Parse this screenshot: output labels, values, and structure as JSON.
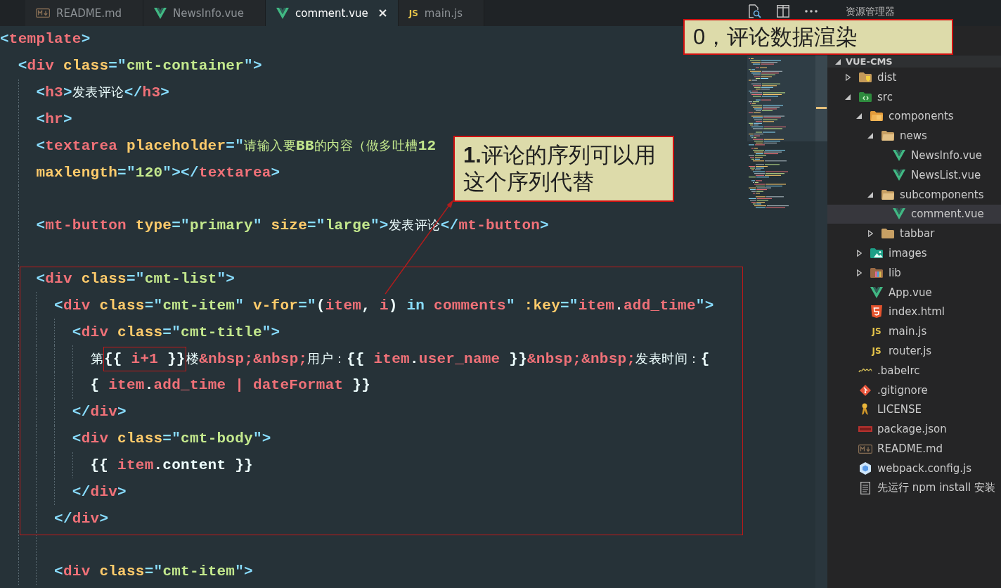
{
  "tabs": [
    {
      "label": "README.md",
      "kind": "markdown",
      "selected": false
    },
    {
      "label": "NewsInfo.vue",
      "kind": "vue",
      "selected": false
    },
    {
      "label": "comment.vue",
      "kind": "vue",
      "selected": true
    },
    {
      "label": "main.js",
      "kind": "js",
      "badge": "JS",
      "selected": false
    }
  ],
  "editor": {
    "lines": [
      {
        "kind": "code",
        "tokens": [
          {
            "kind": "punct",
            "text": "<"
          },
          {
            "kind": "tag",
            "text": "template"
          },
          {
            "kind": "punct",
            "text": ">"
          }
        ],
        "children": [
          {
            "kind": "code",
            "tokens": [
              {
                "kind": "punct",
                "text": "<"
              },
              {
                "kind": "tag",
                "text": "div"
              },
              {
                "kind": "attr",
                "text": " class"
              },
              {
                "kind": "punct",
                "text": "=\""
              },
              {
                "kind": "string",
                "text": "cmt-container"
              },
              {
                "kind": "punct",
                "text": "\">"
              }
            ],
            "children": [
              {
                "kind": "code",
                "tokens": [
                  {
                    "kind": "punct",
                    "text": "<"
                  },
                  {
                    "kind": "tag",
                    "text": "h3"
                  },
                  {
                    "kind": "punct",
                    "text": ">"
                  },
                  {
                    "kind": "text",
                    "text": "发表评论"
                  },
                  {
                    "kind": "punct",
                    "text": "</"
                  },
                  {
                    "kind": "tag",
                    "text": "h3"
                  },
                  {
                    "kind": "punct",
                    "text": ">"
                  }
                ]
              },
              {
                "kind": "code",
                "tokens": [
                  {
                    "kind": "punct",
                    "text": "<"
                  },
                  {
                    "kind": "tag",
                    "text": "hr"
                  },
                  {
                    "kind": "punct",
                    "text": ">"
                  }
                ]
              },
              {
                "kind": "code",
                "tokens": [
                  {
                    "kind": "punct",
                    "text": "<"
                  },
                  {
                    "kind": "tag",
                    "text": "textarea"
                  },
                  {
                    "kind": "attr",
                    "text": " placeholder"
                  },
                  {
                    "kind": "punct",
                    "text": "=\""
                  },
                  {
                    "kind": "string",
                    "text": "请输入要BB的内容（做多吐槽12"
                  }
                ]
              },
              {
                "kind": "code",
                "tokens": [
                  {
                    "kind": "attr",
                    "text": "maxlength"
                  },
                  {
                    "kind": "punct",
                    "text": "=\""
                  },
                  {
                    "kind": "string",
                    "text": "120"
                  },
                  {
                    "kind": "punct",
                    "text": "\"></"
                  },
                  {
                    "kind": "tag",
                    "text": "textarea"
                  },
                  {
                    "kind": "punct",
                    "text": ">"
                  }
                ]
              },
              {
                "kind": "blank"
              },
              {
                "kind": "code",
                "tokens": [
                  {
                    "kind": "punct",
                    "text": "<"
                  },
                  {
                    "kind": "tag",
                    "text": "mt-button"
                  },
                  {
                    "kind": "attr",
                    "text": " type"
                  },
                  {
                    "kind": "punct",
                    "text": "=\""
                  },
                  {
                    "kind": "string",
                    "text": "primary"
                  },
                  {
                    "kind": "punct",
                    "text": "\""
                  },
                  {
                    "kind": "attr",
                    "text": " size"
                  },
                  {
                    "kind": "punct",
                    "text": "=\""
                  },
                  {
                    "kind": "string",
                    "text": "large"
                  },
                  {
                    "kind": "punct",
                    "text": "\">"
                  },
                  {
                    "kind": "text",
                    "text": "发表评论"
                  },
                  {
                    "kind": "punct",
                    "text": "</"
                  },
                  {
                    "kind": "tag",
                    "text": "mt-button"
                  },
                  {
                    "kind": "punct",
                    "text": ">"
                  }
                ]
              },
              {
                "kind": "blank"
              },
              {
                "kind": "code",
                "tokens": [
                  {
                    "kind": "punct",
                    "text": "<"
                  },
                  {
                    "kind": "tag",
                    "text": "div"
                  },
                  {
                    "kind": "attr",
                    "text": " class"
                  },
                  {
                    "kind": "punct",
                    "text": "=\""
                  },
                  {
                    "kind": "string",
                    "text": "cmt-list"
                  },
                  {
                    "kind": "punct",
                    "text": "\">"
                  }
                ],
                "children": [
                  {
                    "kind": "code",
                    "tokens": [
                      {
                        "kind": "punct",
                        "text": "<"
                      },
                      {
                        "kind": "tag",
                        "text": "div"
                      },
                      {
                        "kind": "attr",
                        "text": " class"
                      },
                      {
                        "kind": "punct",
                        "text": "=\""
                      },
                      {
                        "kind": "string",
                        "text": "cmt-item"
                      },
                      {
                        "kind": "punct",
                        "text": "\""
                      },
                      {
                        "kind": "attr",
                        "text": " v-for"
                      },
                      {
                        "kind": "punct",
                        "text": "=\""
                      },
                      {
                        "kind": "text",
                        "text": "("
                      },
                      {
                        "kind": "var",
                        "text": "item"
                      },
                      {
                        "kind": "text",
                        "text": ", "
                      },
                      {
                        "kind": "var",
                        "text": "i"
                      },
                      {
                        "kind": "text",
                        "text": ") "
                      },
                      {
                        "kind": "keyword",
                        "text": "in"
                      },
                      {
                        "kind": "var",
                        "text": " comments"
                      },
                      {
                        "kind": "punct",
                        "text": "\""
                      },
                      {
                        "kind": "attr",
                        "text": " :key"
                      },
                      {
                        "kind": "punct",
                        "text": "=\""
                      },
                      {
                        "kind": "var",
                        "text": "item"
                      },
                      {
                        "kind": "text",
                        "text": "."
                      },
                      {
                        "kind": "var",
                        "text": "add_time"
                      },
                      {
                        "kind": "punct",
                        "text": "\">"
                      }
                    ],
                    "children": [
                      {
                        "kind": "code",
                        "tokens": [
                          {
                            "kind": "punct",
                            "text": "<"
                          },
                          {
                            "kind": "tag",
                            "text": "div"
                          },
                          {
                            "kind": "attr",
                            "text": " class"
                          },
                          {
                            "kind": "punct",
                            "text": "=\""
                          },
                          {
                            "kind": "string",
                            "text": "cmt-title"
                          },
                          {
                            "kind": "punct",
                            "text": "\">"
                          }
                        ],
                        "children": [
                          {
                            "kind": "code",
                            "tokens": [
                              {
                                "kind": "text",
                                "text": "第"
                              },
                              {
                                "kind": "framed",
                                "tokens": [
                                  {
                                    "kind": "text",
                                    "text": "{{ "
                                  },
                                  {
                                    "kind": "var",
                                    "text": "i+1"
                                  },
                                  {
                                    "kind": "text",
                                    "text": " }}"
                                  }
                                ]
                              },
                              {
                                "kind": "text",
                                "text": "楼"
                              },
                              {
                                "kind": "var",
                                "text": "&nbsp;&nbsp;"
                              },
                              {
                                "kind": "text",
                                "text": "用户：{{ "
                              },
                              {
                                "kind": "var",
                                "text": "item"
                              },
                              {
                                "kind": "text",
                                "text": "."
                              },
                              {
                                "kind": "var",
                                "text": "user_name"
                              },
                              {
                                "kind": "text",
                                "text": " }}"
                              },
                              {
                                "kind": "var",
                                "text": "&nbsp;&nbsp;"
                              },
                              {
                                "kind": "text",
                                "text": "发表时间：{"
                              }
                            ]
                          },
                          {
                            "kind": "code",
                            "tokens": [
                              {
                                "kind": "text",
                                "text": "{ "
                              },
                              {
                                "kind": "var",
                                "text": "item"
                              },
                              {
                                "kind": "text",
                                "text": "."
                              },
                              {
                                "kind": "var",
                                "text": "add_time | dateFormat"
                              },
                              {
                                "kind": "text",
                                "text": " }}"
                              }
                            ]
                          }
                        ]
                      },
                      {
                        "kind": "code",
                        "tokens": [
                          {
                            "kind": "punct",
                            "text": "</"
                          },
                          {
                            "kind": "tag",
                            "text": "div"
                          },
                          {
                            "kind": "punct",
                            "text": ">"
                          }
                        ]
                      },
                      {
                        "kind": "code",
                        "tokens": [
                          {
                            "kind": "punct",
                            "text": "<"
                          },
                          {
                            "kind": "tag",
                            "text": "div"
                          },
                          {
                            "kind": "attr",
                            "text": " class"
                          },
                          {
                            "kind": "punct",
                            "text": "=\""
                          },
                          {
                            "kind": "string",
                            "text": "cmt-body"
                          },
                          {
                            "kind": "punct",
                            "text": "\">"
                          }
                        ],
                        "children": [
                          {
                            "kind": "code",
                            "tokens": [
                              {
                                "kind": "text",
                                "text": "{{ "
                              },
                              {
                                "kind": "var",
                                "text": "item"
                              },
                              {
                                "kind": "text",
                                "text": ".content }}"
                              }
                            ]
                          }
                        ]
                      },
                      {
                        "kind": "code",
                        "tokens": [
                          {
                            "kind": "punct",
                            "text": "</"
                          },
                          {
                            "kind": "tag",
                            "text": "div"
                          },
                          {
                            "kind": "punct",
                            "text": ">"
                          }
                        ]
                      }
                    ]
                  },
                  {
                    "kind": "code",
                    "tokens": [
                      {
                        "kind": "punct",
                        "text": "</"
                      },
                      {
                        "kind": "tag",
                        "text": "div"
                      },
                      {
                        "kind": "punct",
                        "text": ">"
                      }
                    ]
                  },
                  {
                    "kind": "blank"
                  },
                  {
                    "kind": "code",
                    "tokens": [
                      {
                        "kind": "punct",
                        "text": "<"
                      },
                      {
                        "kind": "tag",
                        "text": "div"
                      },
                      {
                        "kind": "attr",
                        "text": " class"
                      },
                      {
                        "kind": "punct",
                        "text": "=\""
                      },
                      {
                        "kind": "string",
                        "text": "cmt-item"
                      },
                      {
                        "kind": "punct",
                        "text": "\">"
                      }
                    ]
                  }
                ]
              }
            ]
          }
        ]
      }
    ]
  },
  "sidebar": {
    "title": "资源管理器",
    "project": {
      "name": "VUE-CMS",
      "expanded": true
    },
    "tree": [
      {
        "name": "dist",
        "kind": "distfolder",
        "expanded": false,
        "selected": false
      },
      {
        "name": "src",
        "kind": "srcfolder",
        "expanded": true,
        "selected": false,
        "children": [
          {
            "name": "components",
            "kind": "componentsfolder",
            "expanded": true,
            "selected": false,
            "children": [
              {
                "name": "news",
                "kind": "folder",
                "expanded": true,
                "selected": false,
                "children": [
                  {
                    "name": "NewsInfo.vue",
                    "kind": "vue",
                    "selected": false
                  },
                  {
                    "name": "NewsList.vue",
                    "kind": "vue",
                    "selected": false
                  }
                ]
              },
              {
                "name": "subcomponents",
                "kind": "folder",
                "expanded": true,
                "selected": false,
                "children": [
                  {
                    "name": "comment.vue",
                    "kind": "vue",
                    "selected": true
                  }
                ]
              },
              {
                "name": "tabbar",
                "kind": "folder",
                "expanded": false,
                "selected": false
              }
            ]
          },
          {
            "name": "images",
            "kind": "imagesfolder",
            "expanded": false,
            "selected": false
          },
          {
            "name": "lib",
            "kind": "libfolder",
            "expanded": false,
            "selected": false
          },
          {
            "name": "App.vue",
            "kind": "vue",
            "selected": false
          },
          {
            "name": "index.html",
            "kind": "html",
            "selected": false
          },
          {
            "name": "main.js",
            "kind": "js",
            "badge": "JS",
            "selected": false
          },
          {
            "name": "router.js",
            "kind": "js",
            "badge": "JS",
            "selected": false
          }
        ]
      },
      {
        "name": ".babelrc",
        "kind": "babel",
        "selected": false
      },
      {
        "name": ".gitignore",
        "kind": "git",
        "selected": false
      },
      {
        "name": "LICENSE",
        "kind": "license",
        "selected": false
      },
      {
        "name": "package.json",
        "kind": "npm",
        "selected": false
      },
      {
        "name": "README.md",
        "kind": "markdown",
        "selected": false
      },
      {
        "name": "webpack.config.js",
        "kind": "webpack",
        "selected": false
      },
      {
        "name": "先运行 npm install 安装",
        "kind": "text",
        "selected": false
      }
    ]
  },
  "callouts": [
    {
      "text": "0，评论数据渲染"
    },
    {
      "text": "**1.**评论的序列可以用这个序列代替"
    }
  ]
}
